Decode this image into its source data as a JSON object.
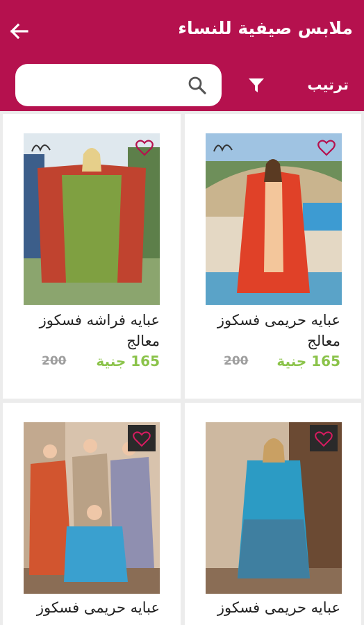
{
  "header": {
    "title": "ملابس صيفية للنساء",
    "sort_label": "ترتيب",
    "back_icon": "arrow-left-icon",
    "filter_icon": "filter-icon"
  },
  "search": {
    "placeholder": "",
    "value": "",
    "icon": "search-icon"
  },
  "colors": {
    "accent": "#b5114e",
    "price_new": "#8bc34a",
    "price_old": "#9e9e9e",
    "background": "#ececec"
  },
  "products": [
    {
      "name": "عبايه حريمى فسكوز معالج",
      "price_new": "165 جنية",
      "price_old": "200",
      "favorite_icon": "heart-outline-icon"
    },
    {
      "name": "عبايه فراشه فسكوز معالج",
      "price_new": "165 جنية",
      "price_old": "200",
      "favorite_icon": "heart-outline-icon"
    },
    {
      "name": "عبايه حريمى فسكوز"
    },
    {
      "name": "عبايه حريمى فسكوز"
    }
  ]
}
